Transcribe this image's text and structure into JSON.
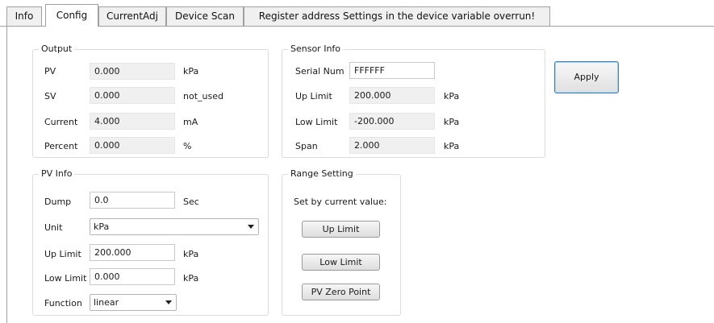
{
  "tabs": [
    "Info",
    "Config",
    "CurrentAdj",
    "Device Scan",
    "Register address Settings in the device variable overrun!"
  ],
  "output": {
    "title": "Output",
    "rows": [
      {
        "label": "PV",
        "value": "0.000",
        "unit": "kPa"
      },
      {
        "label": "SV",
        "value": "0.000",
        "unit": "not_used"
      },
      {
        "label": "Current",
        "value": "4.000",
        "unit": "mA"
      },
      {
        "label": "Percent",
        "value": "0.000",
        "unit": "%"
      }
    ]
  },
  "sensor_info": {
    "title": "Sensor Info",
    "serial_label": "Serial Num",
    "serial_value": "FFFFFF",
    "rows": [
      {
        "label": "Up Limit",
        "value": "200.000",
        "unit": "kPa"
      },
      {
        "label": "Low Limit",
        "value": "-200.000",
        "unit": "kPa"
      },
      {
        "label": "Span",
        "value": "2.000",
        "unit": "kPa"
      }
    ]
  },
  "apply_label": "Apply",
  "pv_info": {
    "title": "PV Info",
    "dump_label": "Dump",
    "dump_value": "0.0",
    "dump_unit": "Sec",
    "unit_label": "Unit",
    "unit_value": "kPa",
    "up_label": "Up Limit",
    "up_value": "200.000",
    "up_unit": "kPa",
    "low_label": "Low Limit",
    "low_value": "0.000",
    "low_unit": "kPa",
    "function_label": "Function",
    "function_value": "linear"
  },
  "range_setting": {
    "title": "Range Setting",
    "caption": "Set by current value:",
    "up_button": "Up Limit",
    "low_button": "Low Limit",
    "zero_button": "PV Zero Point"
  }
}
